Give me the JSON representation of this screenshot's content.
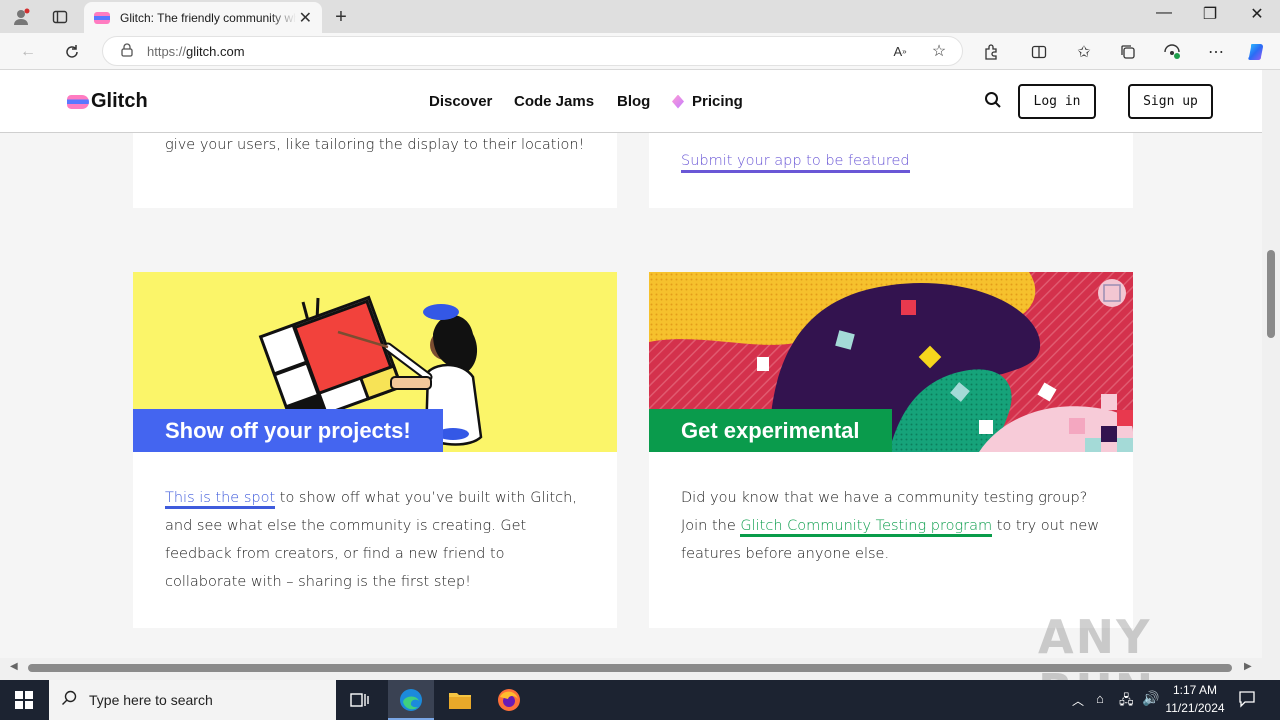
{
  "browser": {
    "tab_title": "Glitch: The friendly community where everyone can discover & create the best apps on the web",
    "url_protocol": "https://",
    "url_host": "glitch.com",
    "icons": [
      "profile-icon",
      "tab-actions-icon",
      "new-tab-icon",
      "back-icon",
      "refresh-icon",
      "lock-icon",
      "read-aloud-icon",
      "favorite-star-icon",
      "extensions-icon",
      "split-screen-icon",
      "favorites-icon",
      "collections-icon",
      "performance-icon",
      "more-icon",
      "copilot-icon",
      "minimize-icon",
      "restore-icon",
      "close-icon"
    ]
  },
  "header": {
    "logo_text": "Glitch",
    "nav": [
      "Discover",
      "Code Jams",
      "Blog",
      "Pricing"
    ],
    "login_label": "Log in",
    "signup_label": "Sign up"
  },
  "cards_top": {
    "left_text": "give your users, like tailoring the display to their location!",
    "right_link": "Submit your app to be featured"
  },
  "card_projects": {
    "title": "Show off your projects!",
    "link_text": "This is the spot",
    "text_after_link": " to show off what you’ve built with Glitch, and see what else the community is creating. Get feedback from creators, or find a new friend to collaborate with – sharing is the first step!",
    "banner_color": "#fbf569",
    "title_color": "#4465f0"
  },
  "card_experimental": {
    "title": "Get experimental",
    "text_before_link": "Did you know that we have a community testing group? Join the ",
    "link_text": "Glitch Community Testing program",
    "text_after_link": " to try out new features before anyone else.",
    "title_color": "#0a9b4c"
  },
  "taskbar": {
    "search_placeholder": "Type here to search",
    "time": "1:17 AM",
    "date": "11/21/2024"
  },
  "watermark": "ANY RUN"
}
